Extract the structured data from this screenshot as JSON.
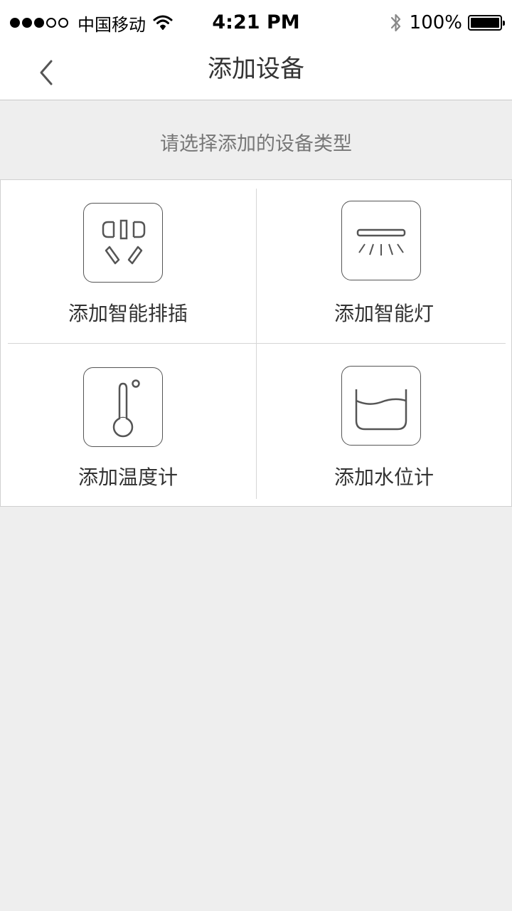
{
  "status_bar": {
    "carrier": "中国移动",
    "time": "4:21 PM",
    "battery": "100%",
    "signal_bars_filled": 3,
    "signal_bars_total": 5
  },
  "nav": {
    "title": "添加设备",
    "back_icon": "chevron-left-icon"
  },
  "subtitle": "请选择添加的设备类型",
  "devices": [
    {
      "label": "添加智能排插",
      "icon": "power-strip-icon"
    },
    {
      "label": "添加智能灯",
      "icon": "smart-light-icon"
    },
    {
      "label": "添加温度计",
      "icon": "thermometer-icon"
    },
    {
      "label": "添加水位计",
      "icon": "water-level-icon"
    }
  ],
  "colors": {
    "background": "#eeeeee",
    "surface": "#ffffff",
    "divider": "#d6d6d6",
    "text": "#333333",
    "subtitle_text": "#777777"
  }
}
